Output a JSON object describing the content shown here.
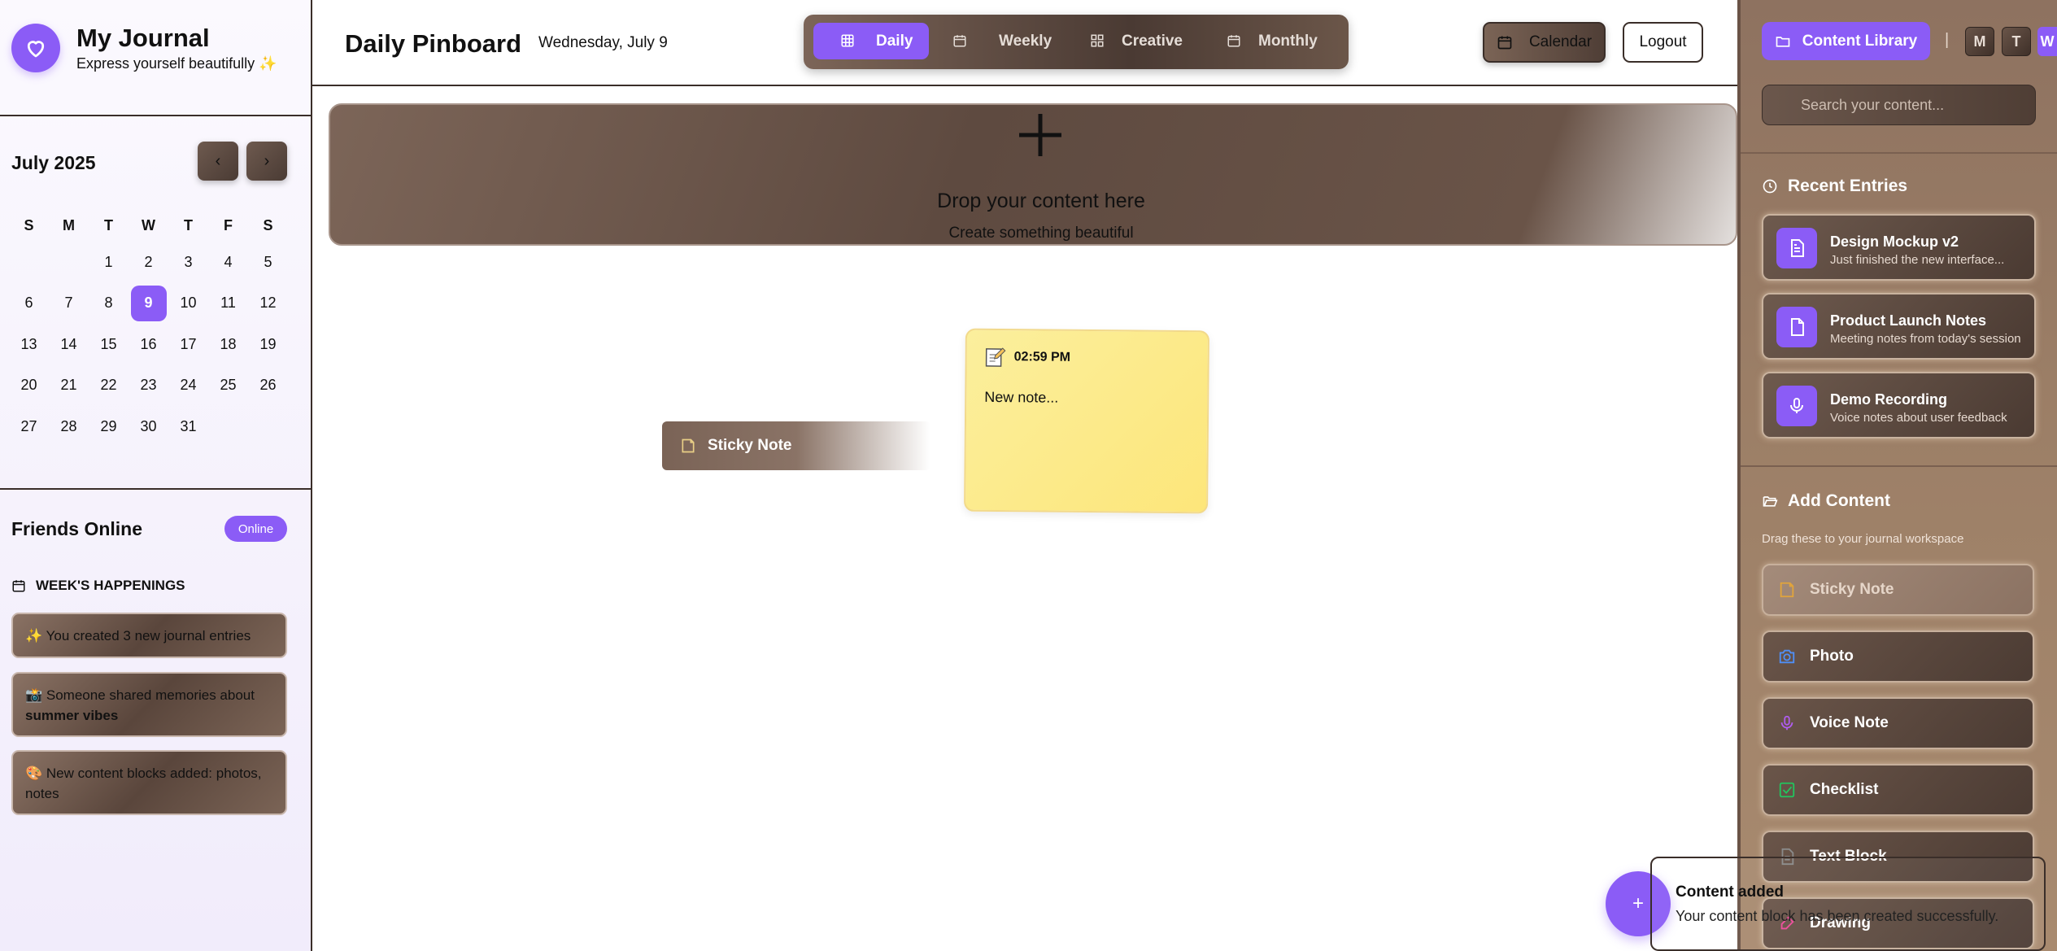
{
  "app": {
    "title": "My Journal",
    "subtitle": "Express yourself beautifully ✨"
  },
  "calendar": {
    "month_label": "July 2025",
    "prev_label": "‹",
    "next_label": "›",
    "weekdays": [
      "S",
      "M",
      "T",
      "W",
      "T",
      "F",
      "S"
    ],
    "leading_blanks": 2,
    "days": [
      "1",
      "2",
      "3",
      "4",
      "5",
      "6",
      "7",
      "8",
      "9",
      "10",
      "11",
      "12",
      "13",
      "14",
      "15",
      "16",
      "17",
      "18",
      "19",
      "20",
      "21",
      "22",
      "23",
      "24",
      "25",
      "26",
      "27",
      "28",
      "29",
      "30",
      "31"
    ],
    "selected_day": "9"
  },
  "friends": {
    "title": "Friends Online",
    "badge": "Online"
  },
  "happenings": {
    "title": "WEEK'S HAPPENINGS",
    "items": [
      {
        "text": "✨ You created 3 new journal entries",
        "bold": ""
      },
      {
        "text": "📸 Someone shared memories about ",
        "bold": "summer vibes"
      },
      {
        "text": "🎨 New content blocks added: photos, notes",
        "bold": ""
      }
    ]
  },
  "header": {
    "title": "Daily Pinboard",
    "date": "Wednesday, July 9",
    "tabs": [
      "Daily",
      "Weekly",
      "Creative",
      "Monthly"
    ],
    "active_tab": "Daily",
    "calendar_button": "Calendar",
    "logout_button": "Logout"
  },
  "dropzone": {
    "title": "Drop your content here",
    "subtitle": "Create something beautiful"
  },
  "board": {
    "dragging_item": "Sticky Note",
    "note": {
      "time": "02:59 PM",
      "body": "New note..."
    }
  },
  "fab_label": "+",
  "toast": {
    "title": "Content added",
    "description": "Your content block has been created successfully."
  },
  "right_panel": {
    "library_button": "Content Library",
    "divider": "|",
    "mini_buttons": [
      "M",
      "T",
      "W"
    ],
    "search_placeholder": "Search your content...",
    "recent_title": "Recent Entries",
    "recent": [
      {
        "title": "Design Mockup v2",
        "desc": "Just finished the new interface...",
        "icon": "document-icon"
      },
      {
        "title": "Product Launch Notes",
        "desc": "Meeting notes from today's session",
        "icon": "file-icon"
      },
      {
        "title": "Demo Recording",
        "desc": "Voice notes about user feedback",
        "icon": "microphone-icon"
      }
    ],
    "add_title": "Add Content",
    "add_hint": "Drag these to your journal workspace",
    "add_items": [
      {
        "label": "Sticky Note",
        "icon": "sticky-note-icon",
        "color": "#e0a43c"
      },
      {
        "label": "Photo",
        "icon": "camera-icon",
        "color": "#4f8ff7"
      },
      {
        "label": "Voice Note",
        "icon": "microphone-icon",
        "color": "#b05cf0"
      },
      {
        "label": "Checklist",
        "icon": "checkbox-icon",
        "color": "#22c55e"
      },
      {
        "label": "Text Block",
        "icon": "text-icon",
        "color": "#8a8a8a"
      },
      {
        "label": "Drawing",
        "icon": "brush-icon",
        "color": "#ec4899"
      }
    ]
  },
  "colors": {
    "accent": "#8b5cf6",
    "brown_dark": "#4a3a32",
    "note_yellow": "#fde67a"
  }
}
